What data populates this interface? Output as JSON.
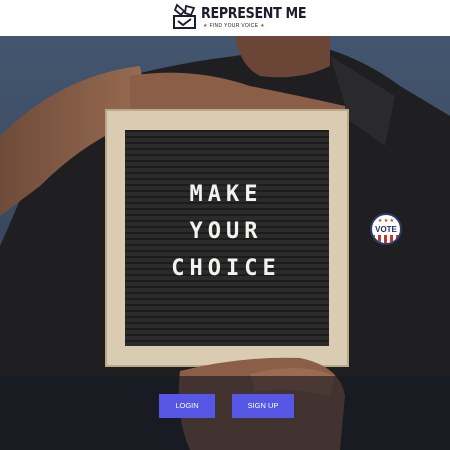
{
  "header": {
    "brand": "REPRESENT ME",
    "tagline": "FIND YOUR VOICE"
  },
  "hero": {
    "board_lines": [
      "MAKE",
      "YOUR",
      "CHOICE"
    ],
    "badge_text": "VOTE"
  },
  "actions": {
    "login_label": "LOGIN",
    "signup_label": "SIGN UP"
  },
  "colors": {
    "button": "#5757e6",
    "brand_text": "#1d1d2e",
    "tagline_star": "#d23b3b",
    "background_blue": "#3b4f6b"
  }
}
